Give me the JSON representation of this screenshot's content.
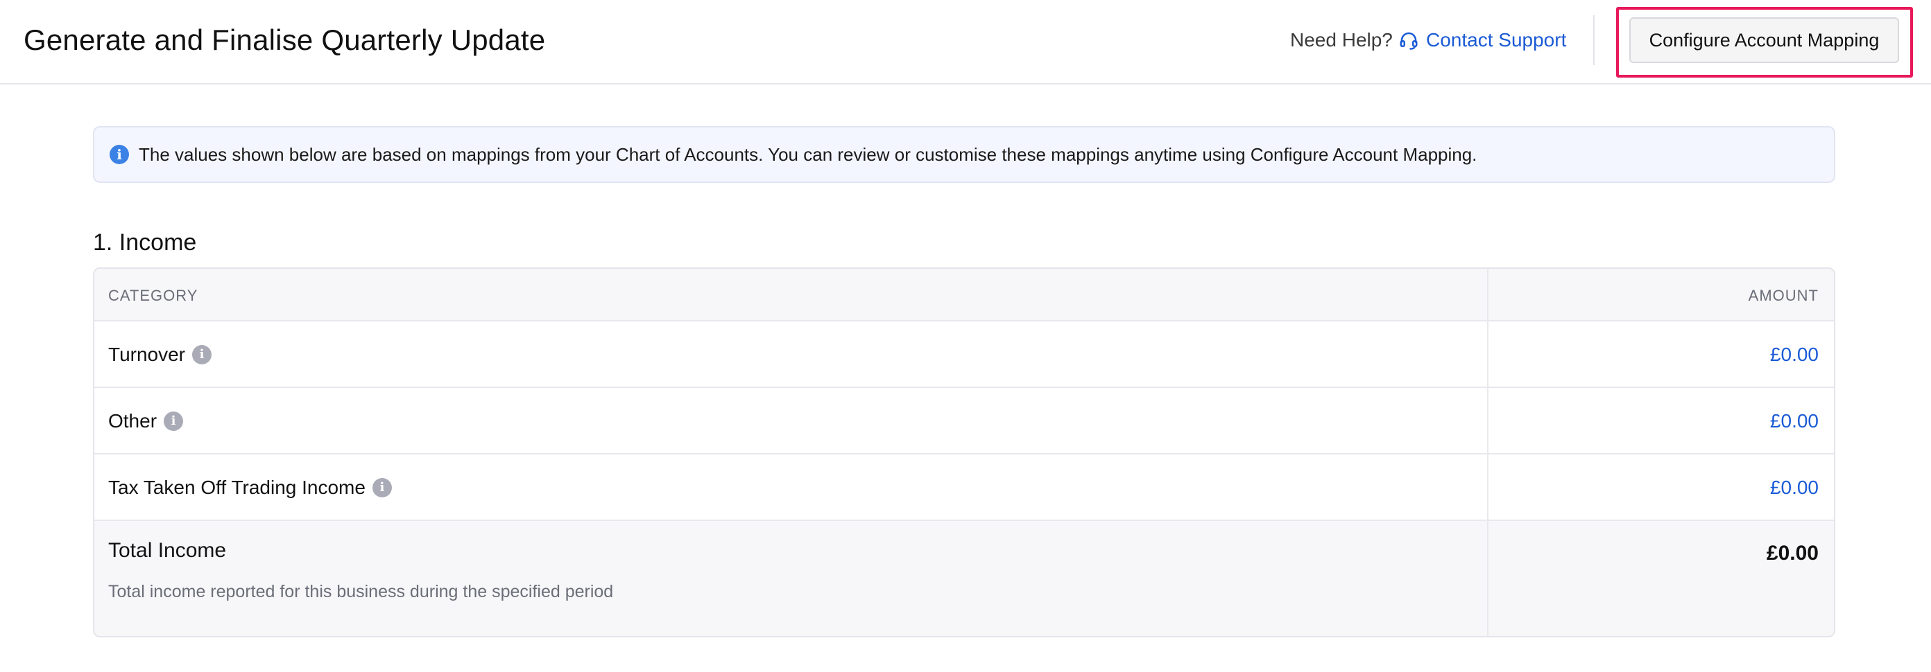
{
  "header": {
    "title": "Generate and Finalise Quarterly Update",
    "help_text": "Need Help?",
    "support_link": "Contact Support",
    "configure_button": "Configure Account Mapping"
  },
  "banner": {
    "text": "The values shown below are based on mappings from your Chart of Accounts. You can review or customise these mappings anytime using Configure Account Mapping."
  },
  "income": {
    "section_title": "1. Income",
    "columns": {
      "category": "CATEGORY",
      "amount": "AMOUNT"
    },
    "rows": [
      {
        "label": "Turnover",
        "amount": "£0.00"
      },
      {
        "label": "Other",
        "amount": "£0.00"
      },
      {
        "label": "Tax Taken Off Trading Income",
        "amount": "£0.00"
      }
    ],
    "total": {
      "label": "Total Income",
      "description": "Total income reported for this business during the specified period",
      "amount": "£0.00"
    }
  },
  "colors": {
    "link": "#1b5bd6",
    "highlight": "#e8195a",
    "info": "#3b82e6"
  }
}
